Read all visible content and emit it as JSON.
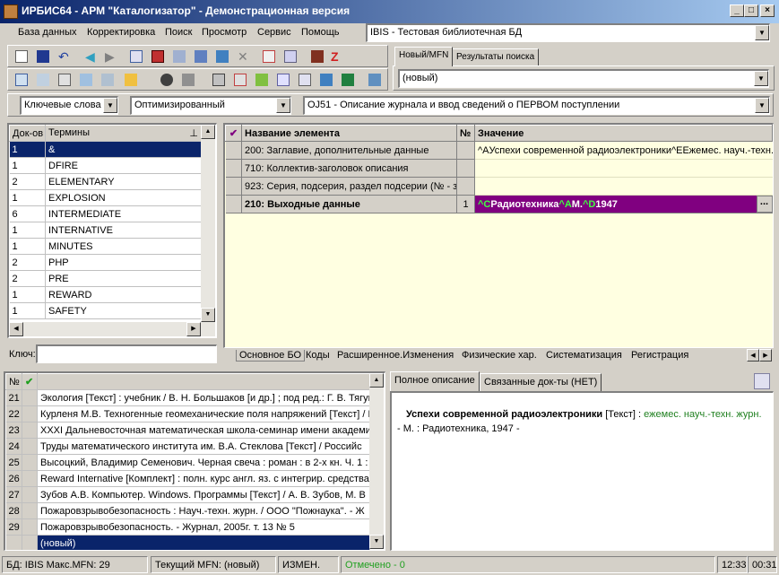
{
  "window": {
    "title": "ИРБИС64 - АРМ \"Каталогизатор\" - Демонстрационная версия"
  },
  "menu": [
    "База данных",
    "Корректировка",
    "Поиск",
    "Просмотр",
    "Сервис",
    "Помощь"
  ],
  "db_select": {
    "value": "IBIS - Тестовая библиотечная БД"
  },
  "search_tabs": [
    "Новый/MFN",
    "Результаты поиска"
  ],
  "mfn_select": {
    "value": "(новый)"
  },
  "filters": {
    "search_type": "Ключевые слова",
    "mode": "Оптимизированный",
    "worksheet": "OJ51 - Описание журнала и ввод сведений о ПЕРВОМ поступлении"
  },
  "terms": {
    "headers": [
      "Док-ов",
      "Термины"
    ],
    "rows": [
      {
        "count": "1",
        "term": "&"
      },
      {
        "count": "1",
        "term": "DFIRE"
      },
      {
        "count": "2",
        "term": "ELEMENTARY"
      },
      {
        "count": "1",
        "term": "EXPLOSION"
      },
      {
        "count": "6",
        "term": "INTERMEDIATE"
      },
      {
        "count": "1",
        "term": "INTERNATIVE"
      },
      {
        "count": "1",
        "term": "MINUTES"
      },
      {
        "count": "2",
        "term": "PHP"
      },
      {
        "count": "2",
        "term": "PRE"
      },
      {
        "count": "1",
        "term": "REWARD"
      },
      {
        "count": "1",
        "term": "SAFETY"
      }
    ],
    "key_label": "Ключ:"
  },
  "editor": {
    "headers": {
      "name": "Название элемента",
      "num": "№",
      "value": "Значение"
    },
    "rows": [
      {
        "name": "200: Заглавие, дополнительные данные",
        "num": "",
        "value": "^AУспехи современной радиоэлектроники^EЕжемес. науч.-техн."
      },
      {
        "name": "710: Коллектив-заголовок описания",
        "num": "",
        "value": ""
      },
      {
        "name": "923: Серия, подсерия, раздел подсерии (№ - за",
        "num": "",
        "value": ""
      },
      {
        "name": "210: Выходные данные",
        "num": "1",
        "value": "^CРадиотехника^AM.^D1947"
      }
    ],
    "tabs": [
      "Основное БО",
      "Коды",
      "Расширенное.Изменения",
      "Физические хар.",
      "Систематизация",
      "Регистрация"
    ]
  },
  "records": {
    "headers": [
      "№"
    ],
    "rows": [
      {
        "n": "21",
        "text": "Экология [Текст] : учебник / В. Н. Большаков [и др.] ; под ред.: Г. В. Тягун"
      },
      {
        "n": "22",
        "text": "Курленя М.В. Техногенные геомеханические поля напряжений [Текст] / М"
      },
      {
        "n": "23",
        "text": "XXXI Дальневосточная математическая школа-семинар имени академи"
      },
      {
        "n": "24",
        "text": "Труды математического института им. В.А. Стеклова [Текст] / Российс"
      },
      {
        "n": "25",
        "text": "Высоцкий, Владимир Семенович. Черная свеча : роман : в 2-х кн. Ч. 1 : П"
      },
      {
        "n": "26",
        "text": "Reward Internative [Комплект] : полн. курс англ. яз. с интегрир. средства"
      },
      {
        "n": "27",
        "text": "Зубов А.В. Компьютер. Windows. Программы [Текст] / А. В. Зубов, М. В"
      },
      {
        "n": "28",
        "text": "Пожаровзрывобезопасность : Науч.-техн. журн. / ООО \"Пожнаука\". - Ж"
      },
      {
        "n": "29",
        "text": "Пожаровзрывобезопасность. - Журнал, 2005г. т. 13 № 5"
      }
    ],
    "new_label": "(новый)"
  },
  "preview": {
    "tabs": [
      "Полное описание",
      "Связанные док-ты (НЕТ)"
    ],
    "title": "Успехи современной радиоэлектроники",
    "type": "[Текст] :",
    "subtitle": "ежемес. науч.-техн. журн.",
    "rest": "- М. : Радиотехника, 1947 -"
  },
  "status": {
    "db": "БД: IBIS Макс.MFN: 29",
    "mfn": "Текущий MFN: (новый)",
    "changed": "ИЗМЕН.",
    "marked": "Отмечено - 0",
    "time1": "12:33",
    "time2": "00:31"
  },
  "colors": {
    "accent": "#800080",
    "selection": "#0a246a",
    "editor_bg": "#ffffe1"
  }
}
